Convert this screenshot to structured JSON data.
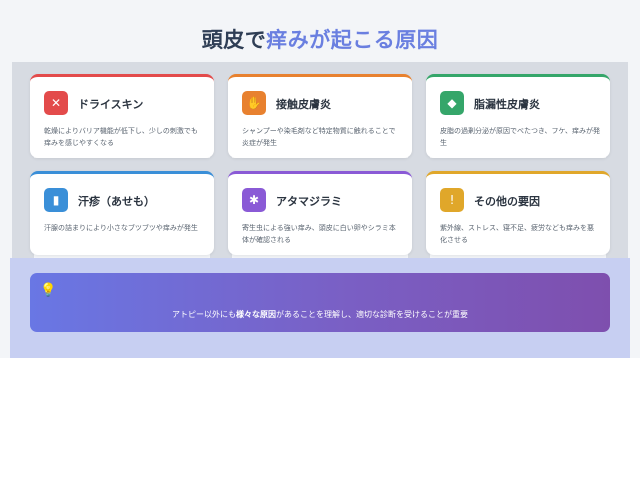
{
  "title": {
    "before": "頭皮で",
    "highlight": "痒みが起こる原因"
  },
  "cards": [
    {
      "title": "ドライスキン",
      "desc": "乾燥によりバリア機能が低下し、少しの刺激でも痒みを感じやすくなる",
      "color": "#e34b4b",
      "icon": "no-water-icon",
      "glyph": "✕"
    },
    {
      "title": "接触皮膚炎",
      "desc": "シャンプーや染毛剤など特定物質に触れることで炎症が発生",
      "color": "#e8812f",
      "icon": "hand-icon",
      "glyph": "✋"
    },
    {
      "title": "脂漏性皮膚炎",
      "desc": "皮脂の過剰分泌が原因でべたつき、フケ、痒みが発生",
      "color": "#35a66a",
      "icon": "oil-icon",
      "glyph": "◆"
    },
    {
      "title": "汗疹（あせも）",
      "desc": "汗腺の詰まりにより小さなブツブツや痒みが発生",
      "color": "#3a8fd8",
      "icon": "thermometer-icon",
      "glyph": "▮"
    },
    {
      "title": "アタマジラミ",
      "desc": "寄生虫による強い痒み、頭皮に白い卵やシラミ本体が確認される",
      "color": "#8a5ad6",
      "icon": "bug-icon",
      "glyph": "✱"
    },
    {
      "title": "その他の要因",
      "desc": "紫外線、ストレス、寝不足、疲労なども痒みを悪化させる",
      "color": "#e0a72a",
      "icon": "info-icon",
      "glyph": "!"
    }
  ],
  "banner": {
    "icon": "lightbulb-icon",
    "text_before": "アトピー以外にも",
    "text_bold": "様々な原因",
    "text_after": "があることを理解し、適切な診断を受けることが重要"
  }
}
